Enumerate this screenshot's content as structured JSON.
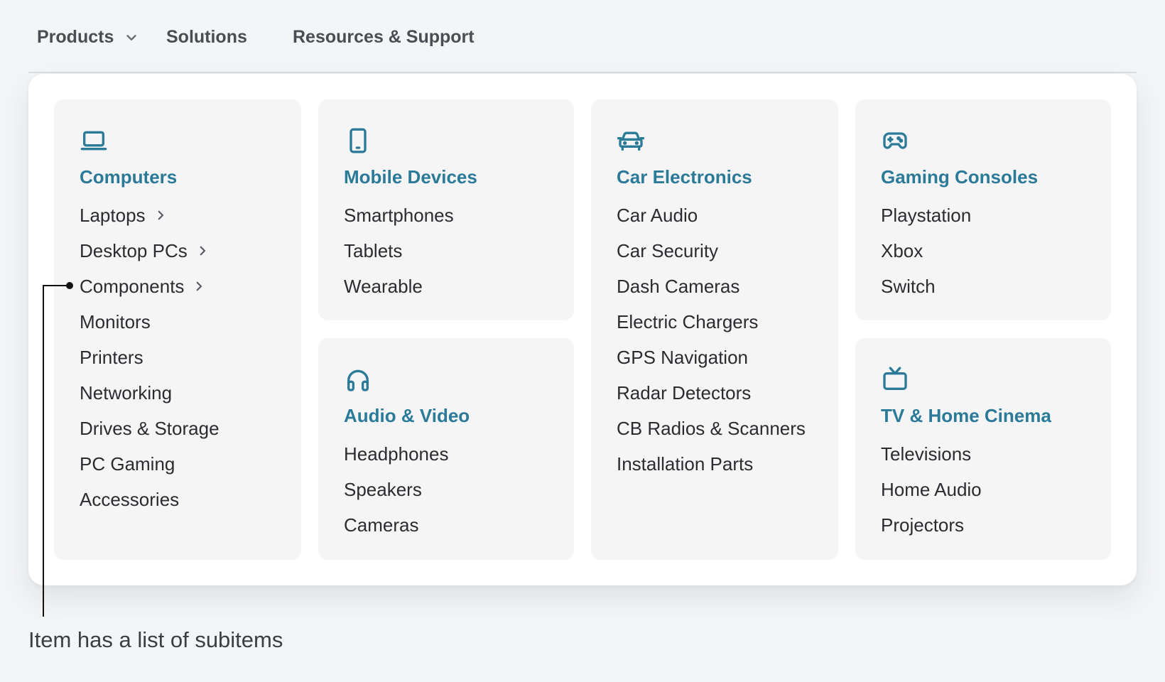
{
  "nav": {
    "products": "Products",
    "solutions": "Solutions",
    "resources": "Resources & Support"
  },
  "cards": {
    "computers": {
      "icon": "laptop-icon",
      "title": "Computers",
      "items": [
        "Laptops",
        "Desktop PCs",
        "Components",
        "Monitors",
        "Printers",
        "Networking",
        "Drives & Storage",
        "PC Gaming",
        "Accessories"
      ]
    },
    "mobile": {
      "icon": "smartphone-icon",
      "title": "Mobile Devices",
      "items": [
        "Smartphones",
        "Tablets",
        "Wearable"
      ]
    },
    "audio": {
      "icon": "headphones-icon",
      "title": "Audio & Video",
      "items": [
        "Headphones",
        "Speakers",
        "Cameras"
      ]
    },
    "car": {
      "icon": "car-icon",
      "title": "Car Electronics",
      "items": [
        "Car Audio",
        "Car Security",
        "Dash Cameras",
        "Electric Chargers",
        "GPS Navigation",
        "Radar Detectors",
        "CB Radios & Scanners",
        "Installation Parts"
      ]
    },
    "gaming": {
      "icon": "gamepad-icon",
      "title": "Gaming Consoles",
      "items": [
        "Playstation",
        "Xbox",
        "Switch"
      ]
    },
    "tv": {
      "icon": "tv-icon",
      "title": "TV & Home Cinema",
      "items": [
        "Televisions",
        "Home Audio",
        "Projectors"
      ]
    }
  },
  "annotation": "Item has a list of subitems",
  "colors": {
    "accent": "#2a7a98",
    "page_bg": "#f4f5f6",
    "card_bg": "#f5f5f6",
    "text": "#2a2c30"
  }
}
